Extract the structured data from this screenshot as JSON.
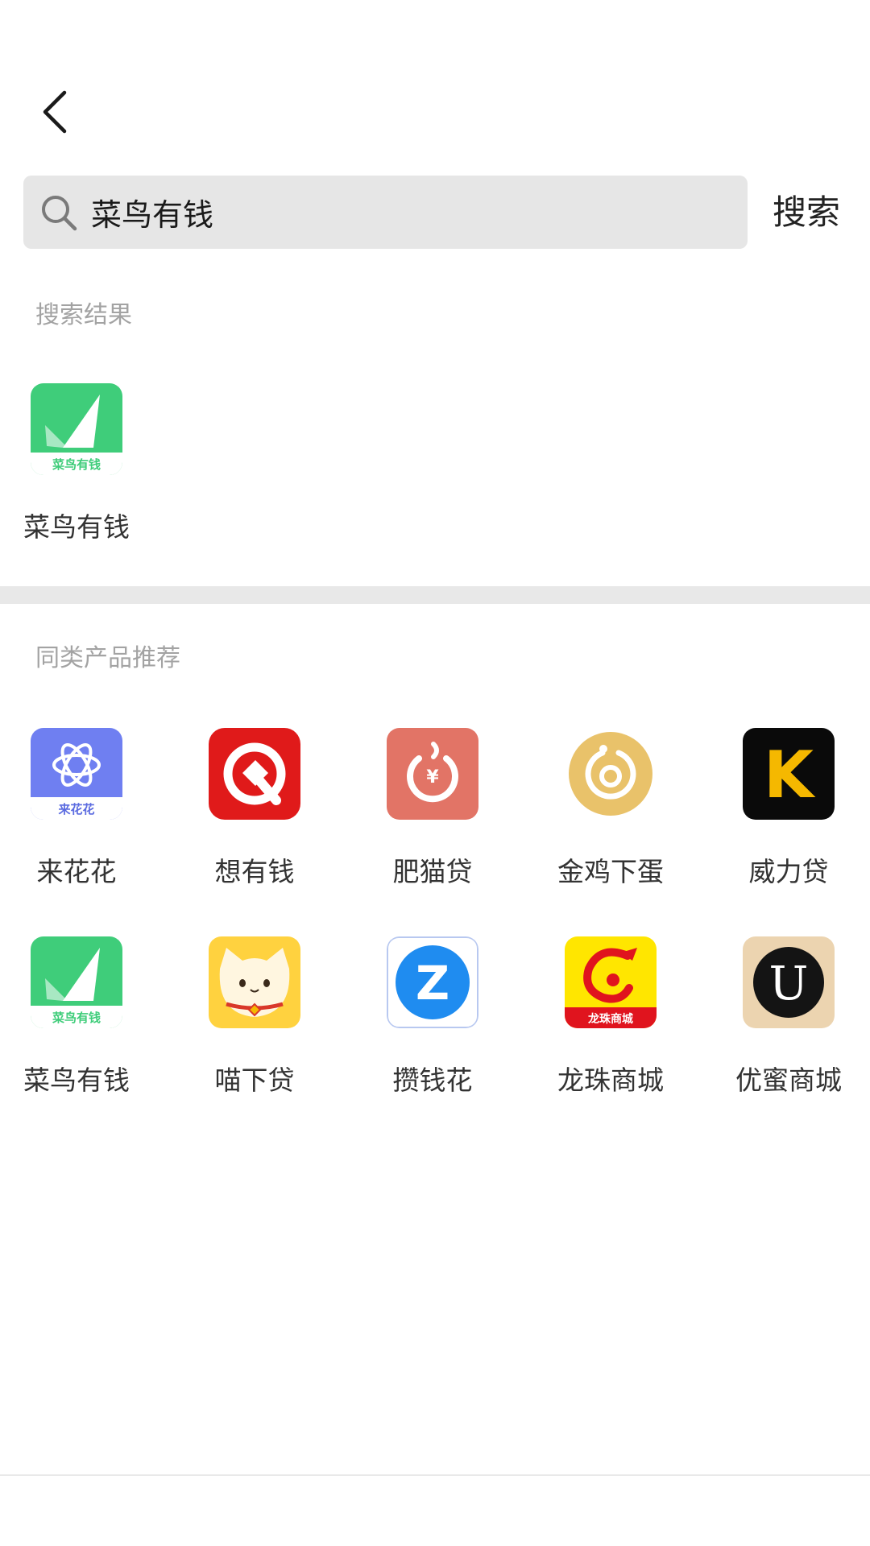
{
  "header": {
    "back_icon": "chevron-left-icon"
  },
  "search": {
    "query": "菜鸟有钱",
    "placeholder": "",
    "button_label": "搜索",
    "icon": "search-icon"
  },
  "results": {
    "title": "搜索结果",
    "items": [
      {
        "label": "菜鸟有钱",
        "icon": "cainiao-youqian-app-icon",
        "icon_text": "菜鸟有钱"
      }
    ]
  },
  "recommendations": {
    "title": "同类产品推荐",
    "items": [
      {
        "label": "来花花",
        "icon": "laihuahua-app-icon",
        "icon_text": "来花花"
      },
      {
        "label": "想有钱",
        "icon": "xiangyouqian-app-icon"
      },
      {
        "label": "肥猫贷",
        "icon": "feimaodai-app-icon",
        "icon_text": "¥"
      },
      {
        "label": "金鸡下蛋",
        "icon": "jinjixiadan-app-icon"
      },
      {
        "label": "威力贷",
        "icon": "weilidai-app-icon",
        "icon_text": "K"
      },
      {
        "label": "菜鸟有钱",
        "icon": "cainiao-youqian-app-icon",
        "icon_text": "菜鸟有钱"
      },
      {
        "label": "喵下贷",
        "icon": "miaoxiadai-app-icon"
      },
      {
        "label": "攒钱花",
        "icon": "zanqianhua-app-icon",
        "icon_text": "Z"
      },
      {
        "label": "龙珠商城",
        "icon": "longzhu-shangcheng-app-icon",
        "icon_text": "龙珠商城"
      },
      {
        "label": "优蜜商城",
        "icon": "youmi-shangcheng-app-icon",
        "icon_text": "U"
      }
    ]
  },
  "colors": {
    "background": "#ffffff",
    "search_bg": "#e6e6e6",
    "section_title": "#a3a3a3",
    "divider": "#e8e8e8",
    "label": "#333333"
  }
}
